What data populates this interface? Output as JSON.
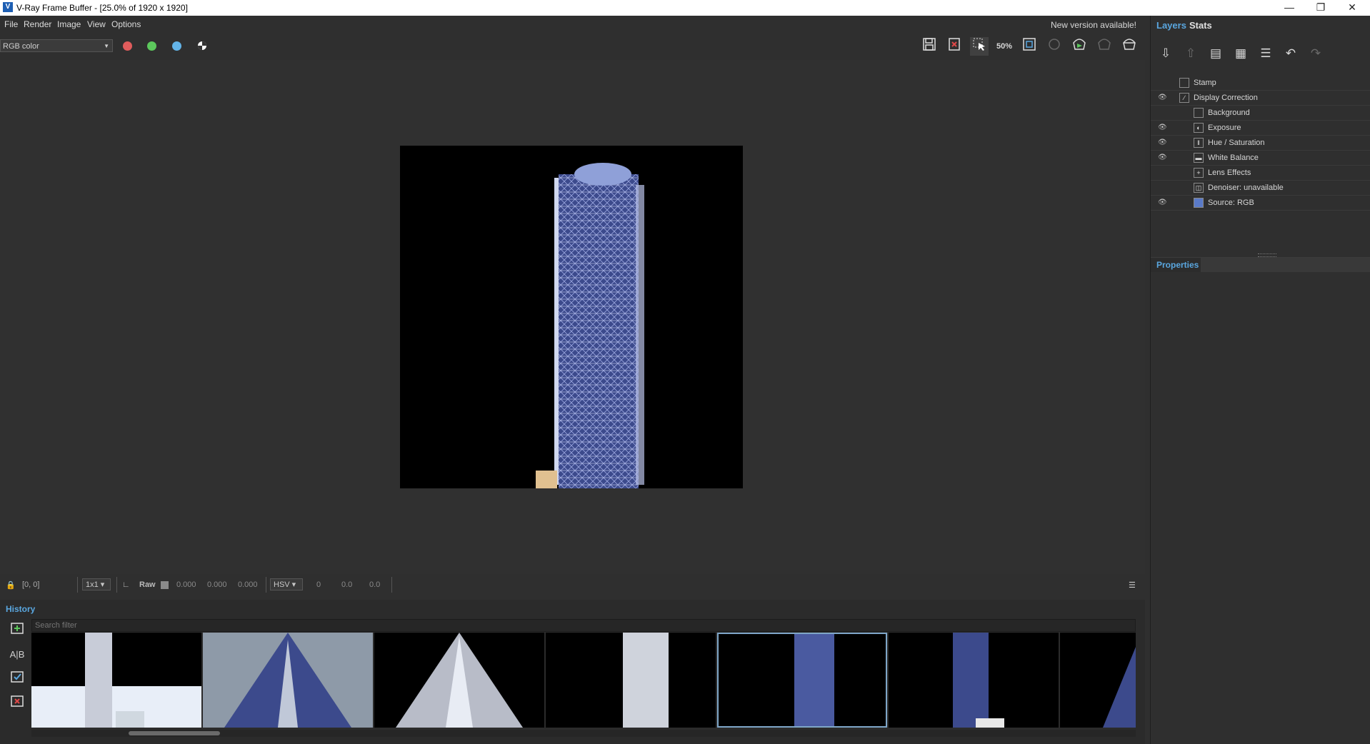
{
  "window": {
    "title": "V-Ray Frame Buffer - [25.0% of 1920 x 1920]",
    "app_icon_letter": "V",
    "minimize_icon": "minimize-icon",
    "maximize_icon": "restore-icon",
    "close_icon": "close-icon"
  },
  "menu": {
    "items": [
      "File",
      "Render",
      "Image",
      "View",
      "Options"
    ],
    "notice": "New version available!"
  },
  "toolbar": {
    "channel": "RGB color",
    "channel_dots": [
      "#e05c5c",
      "#5cc85c",
      "#63b4e8"
    ],
    "icons": [
      "save-icon",
      "clear-icon",
      "track-mouse-icon",
      "fifty-percent-icon",
      "region-render-icon",
      "render-last-icon",
      "start-interactive-icon",
      "stop-icon",
      "render-icon"
    ],
    "zoom_badge": "50%"
  },
  "statusbar": {
    "coords": "[0, 0]",
    "sample": "1x1",
    "raw_label": "Raw",
    "rgb_values": [
      "0.000",
      "0.000",
      "0.000"
    ],
    "colorspace": "HSV",
    "hsv_values": [
      "0",
      "0.0",
      "0.0"
    ]
  },
  "history": {
    "label": "History",
    "search_placeholder": "Search filter",
    "side_icons": [
      "save-to-history-icon",
      "ab-compare-icon",
      "load-icon",
      "remove-icon"
    ],
    "thumbnail_count": 7,
    "selected_index": 4
  },
  "panel": {
    "tabs": [
      "Layers",
      "Stats"
    ],
    "active_tab": "Layers",
    "tool_icons": [
      "load-layer-icon",
      "save-layer-icon",
      "layer-preset-icon",
      "layer-preset2-icon",
      "list-icon",
      "undo-icon",
      "redo-icon"
    ],
    "layers": [
      {
        "name": "Stamp",
        "eye": false,
        "indent": 0
      },
      {
        "name": "Display Correction",
        "eye": true,
        "indent": 0
      },
      {
        "name": "Background",
        "eye": false,
        "indent": 1
      },
      {
        "name": "Exposure",
        "eye": true,
        "indent": 1
      },
      {
        "name": "Hue / Saturation",
        "eye": true,
        "indent": 1
      },
      {
        "name": "White Balance",
        "eye": true,
        "indent": 1
      },
      {
        "name": "Lens Effects",
        "eye": false,
        "indent": 1
      },
      {
        "name": "Denoiser: unavailable",
        "eye": false,
        "indent": 1
      },
      {
        "name": "Source: RGB",
        "eye": true,
        "indent": 1
      }
    ],
    "properties_label": "Properties"
  }
}
